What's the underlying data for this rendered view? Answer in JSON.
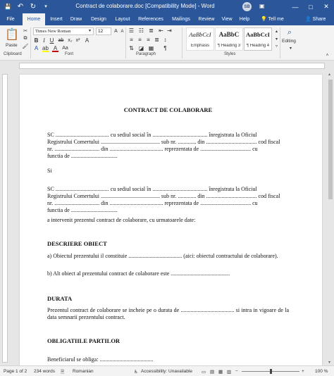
{
  "window": {
    "title": "Contract de colaborare.doc [Compatibility Mode] - Word",
    "avatar_initials": "SB",
    "minimize": "—",
    "maximize": "□",
    "close": "✕"
  },
  "qat": {
    "save": "💾",
    "undo": "↶",
    "redo": "↻"
  },
  "tabs": {
    "file": "File",
    "home": "Home",
    "insert": "Insert",
    "draw": "Draw",
    "design": "Design",
    "layout": "Layout",
    "references": "References",
    "mailings": "Mailings",
    "review": "Review",
    "view": "View",
    "help": "Help",
    "tell_me": "Tell me",
    "share": "Share"
  },
  "ribbon": {
    "clipboard": {
      "paste": "Paste",
      "label": "Clipboard"
    },
    "font": {
      "name": "Times New Roman",
      "size": "12",
      "label": "Font"
    },
    "paragraph": {
      "label": "Paragraph"
    },
    "styles": {
      "label": "Styles",
      "items": [
        {
          "sample": "AaBbCcI",
          "name": "Emphasis"
        },
        {
          "sample": "AaBbC",
          "name": "¶ Heading 3"
        },
        {
          "sample": "AaBbCcI",
          "name": "¶ Heading 4"
        }
      ]
    },
    "editing": {
      "label": "Editing"
    }
  },
  "document": {
    "title": "CONTRACT DE COLABORARE",
    "party1_line1": "SC ...................................... cu sediul social în ....................................... înregistrata la Oficiul",
    "party1_line2": "Registrului Comertului .......................................... sub nr. ............. din .................................... cod fiscal",
    "party1_line3": "nr. ................................ din ...................................... reprezentata de .................................... cu",
    "party1_line4": "functia de .................................",
    "and": "Si",
    "party2_line1": "SC ...................................... cu sediul social în ....................................... înregistrata la Oficiul",
    "party2_line2": "Registrului Comertului .......................................... sub nr. ............. din .................................... cod fiscal",
    "party2_line3": "nr. ................................ din ...................................... reprezentata de .................................... cu",
    "party2_line4": "functia de .................................",
    "intro": "a intervenit prezentul contract de colaborare, cu urmatoarele date:",
    "h_object": "DESCRIERE OBIECT",
    "object_a": "a) Obiectul prezentului il constituie ...................................... (aici: obiectul contractului de colaborare).",
    "object_b": "b) Alt obiect al prezentului contract de colaborare este ..........................................",
    "h_duration": "DURATA",
    "duration_text": "Prezentul contract de colaborare se incheie pe o durata de ...................................... si intra in vigoare de la data semnarii prezentului contract.",
    "h_obligations": "OBLIGATIILE PARTILOR",
    "beneficiary": "Beneficiarul se obliga: ......................................"
  },
  "status": {
    "page": "Page 1 of 2",
    "words": "234 words",
    "language": "Romanian",
    "accessibility": "Accessibility: Unavailable",
    "zoom": "100 %"
  }
}
